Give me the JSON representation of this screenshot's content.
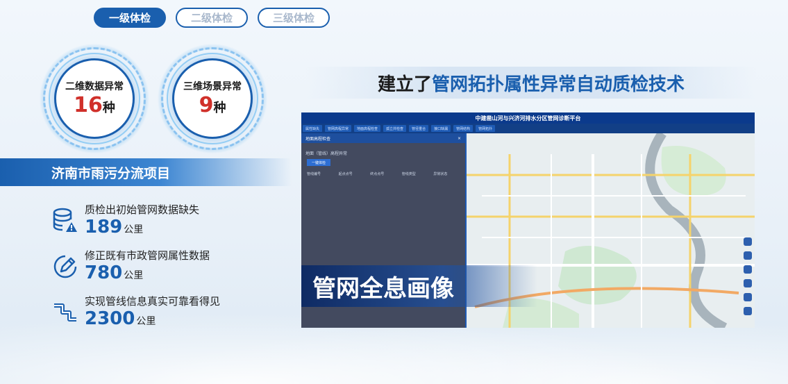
{
  "tabs": [
    {
      "label": "一级体检",
      "active": true
    },
    {
      "label": "二级体检",
      "active": false
    },
    {
      "label": "三级体检",
      "active": false
    }
  ],
  "rings": [
    {
      "label": "二维数据异常",
      "value": "16",
      "unit": "种"
    },
    {
      "label": "三维场景异常",
      "value": "9",
      "unit": "种"
    }
  ],
  "project": {
    "title": "济南市雨污分流项目"
  },
  "stats": [
    {
      "icon": "database-warning-icon",
      "desc": "质检出初始管网数据缺失",
      "value": "189",
      "unit": "公里"
    },
    {
      "icon": "edit-pen-icon",
      "desc": "修正既有市政管网属性数据",
      "value": "780",
      "unit": "公里"
    },
    {
      "icon": "pipe-icon",
      "desc": "实现管线信息真实可靠看得见",
      "value": "2300",
      "unit": "公里"
    }
  ],
  "headline": {
    "dark": "建立了",
    "blue": "管网拓扑属性异常自动质检技术"
  },
  "map": {
    "title": "中建凿山河与兴济河排水分区管网诊断平台",
    "nav": [
      "属性缺失",
      "管网高程异常",
      "地面高程检查",
      "孤立井检查",
      "管径重合",
      "接口缺漏",
      "管网结构",
      "管网拓扑"
    ],
    "panel": {
      "header": "地面高程检查",
      "close": "×",
      "subtitle": "地面（管线）高程异常",
      "button": "一键体检",
      "columns": [
        "管线编号",
        "起点点号",
        "终点点号",
        "管线类型",
        "异常状态"
      ]
    },
    "overlay": "管网全息画像"
  }
}
